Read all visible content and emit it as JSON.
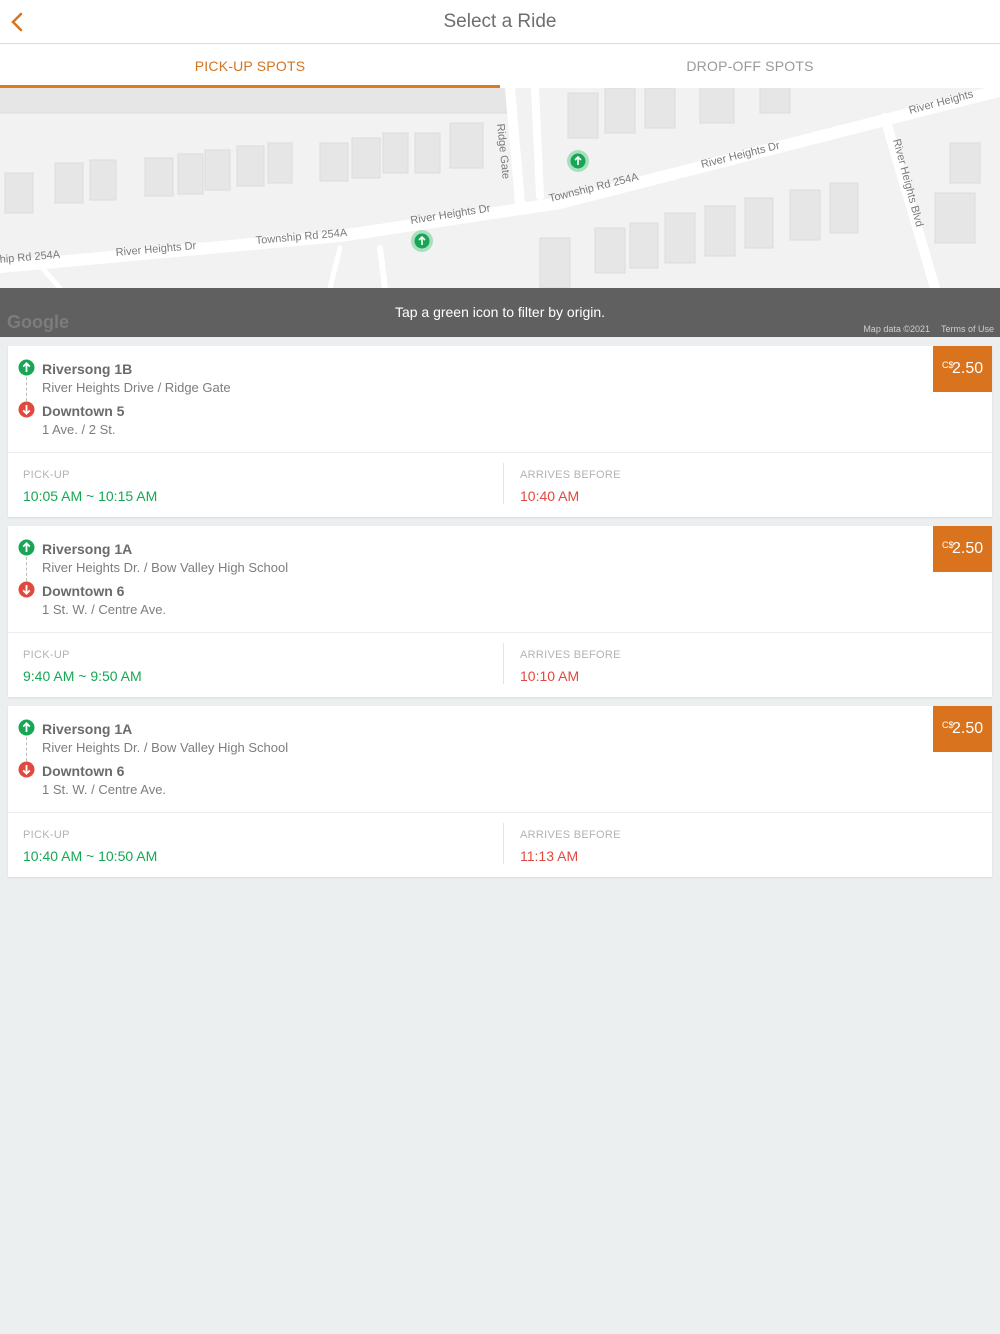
{
  "header": {
    "title": "Select a Ride",
    "back_icon": "chevron-left-icon",
    "accent": "#d9731d"
  },
  "tabs": [
    {
      "label": "PICK-UP SPOTS",
      "active": true
    },
    {
      "label": "DROP-OFF SPOTS",
      "active": false
    }
  ],
  "map": {
    "streets": [
      "River Heights Dr",
      "Township Rd 254A",
      "hip Rd 254A",
      "River Heights Dr",
      "Township Rd 254A",
      "River Heights Dr",
      "Ridge Gate",
      "River Heights Blvd",
      "River Heights"
    ],
    "banner": "Tap a green icon to filter by origin.",
    "google_logo": "Google",
    "map_data": "Map data ©2021",
    "terms": "Terms of Use"
  },
  "labels": {
    "pickup": "PICK-UP",
    "arrives": "ARRIVES BEFORE"
  },
  "rides": [
    {
      "origin": "Riversong 1B",
      "origin_addr": "River Heights Drive / Ridge Gate",
      "dest": "Downtown 5",
      "dest_addr": "1 Ave. / 2 St.",
      "currency": "C$",
      "price": "2.50",
      "pickup": "10:05 AM ~ 10:15 AM",
      "arrives": "10:40 AM"
    },
    {
      "origin": "Riversong 1A",
      "origin_addr": "River Heights Dr. / Bow Valley High School",
      "dest": "Downtown 6",
      "dest_addr": "1 St. W. / Centre Ave.",
      "currency": "C$",
      "price": "2.50",
      "pickup": "9:40 AM ~ 9:50 AM",
      "arrives": "10:10 AM"
    },
    {
      "origin": "Riversong 1A",
      "origin_addr": "River Heights Dr. / Bow Valley High School",
      "dest": "Downtown 6",
      "dest_addr": "1 St. W. / Centre Ave.",
      "currency": "C$",
      "price": "2.50",
      "pickup": "10:40 AM ~ 10:50 AM",
      "arrives": "11:13 AM"
    }
  ]
}
